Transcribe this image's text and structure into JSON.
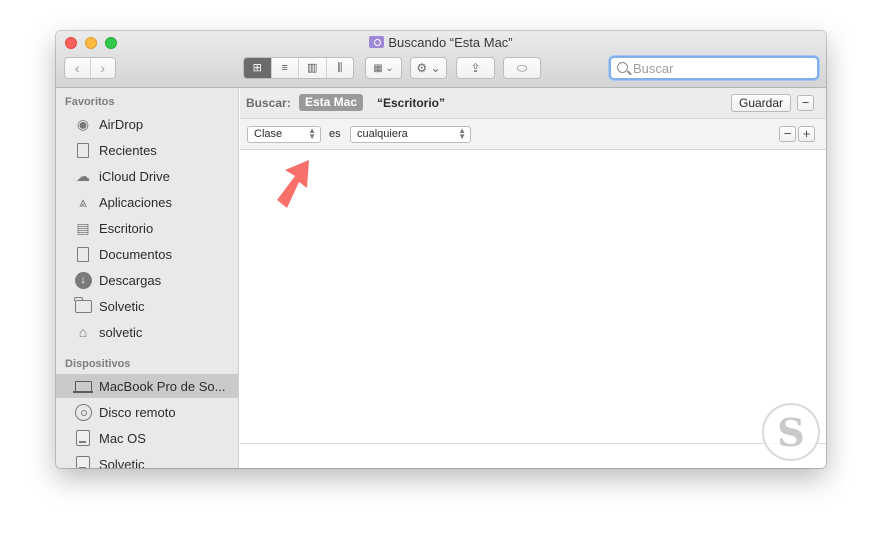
{
  "window": {
    "title": "Buscando “Esta Mac”"
  },
  "toolbar": {
    "back_glyph": "‹",
    "forward_glyph": "›",
    "view_icons": [
      "⊞",
      "≡",
      "▥",
      "⫼"
    ],
    "arrange_glyph": "▦ ⌄",
    "action_glyph": "⚙ ⌄",
    "share_glyph": "⇪",
    "tag_glyph": "⬭",
    "search_placeholder": "Buscar"
  },
  "sidebar": {
    "favorites_header": "Favoritos",
    "favorites": [
      {
        "label": "AirDrop",
        "icon": "airdrop-icon"
      },
      {
        "label": "Recientes",
        "icon": "recents-icon"
      },
      {
        "label": "iCloud Drive",
        "icon": "cloud-icon"
      },
      {
        "label": "Aplicaciones",
        "icon": "applications-icon"
      },
      {
        "label": "Escritorio",
        "icon": "desktop-icon"
      },
      {
        "label": "Documentos",
        "icon": "documents-icon"
      },
      {
        "label": "Descargas",
        "icon": "downloads-icon"
      },
      {
        "label": "Solvetic",
        "icon": "folder-icon"
      },
      {
        "label": "solvetic",
        "icon": "home-icon"
      }
    ],
    "devices_header": "Dispositivos",
    "devices": [
      {
        "label": "MacBook Pro de So...",
        "icon": "laptop-icon",
        "selected": true
      },
      {
        "label": "Disco remoto",
        "icon": "disc-icon"
      },
      {
        "label": "Mac OS",
        "icon": "drive-icon"
      },
      {
        "label": "Solvetic",
        "icon": "drive-icon"
      }
    ]
  },
  "search_bar": {
    "label": "Buscar:",
    "scope_active": "Esta Mac",
    "scope_other": "“Escritorio”",
    "save_label": "Guardar",
    "remove_glyph": "−"
  },
  "criteria": {
    "attribute": "Clase",
    "operator": "es",
    "value": "cualquiera",
    "remove_glyph": "−",
    "add_glyph": "+"
  },
  "watermark": {
    "glyph": "S"
  },
  "colors": {
    "annotation_arrow": "#f9706b",
    "search_focus": "#7fb0ec",
    "selected_row": "#cacaca"
  }
}
